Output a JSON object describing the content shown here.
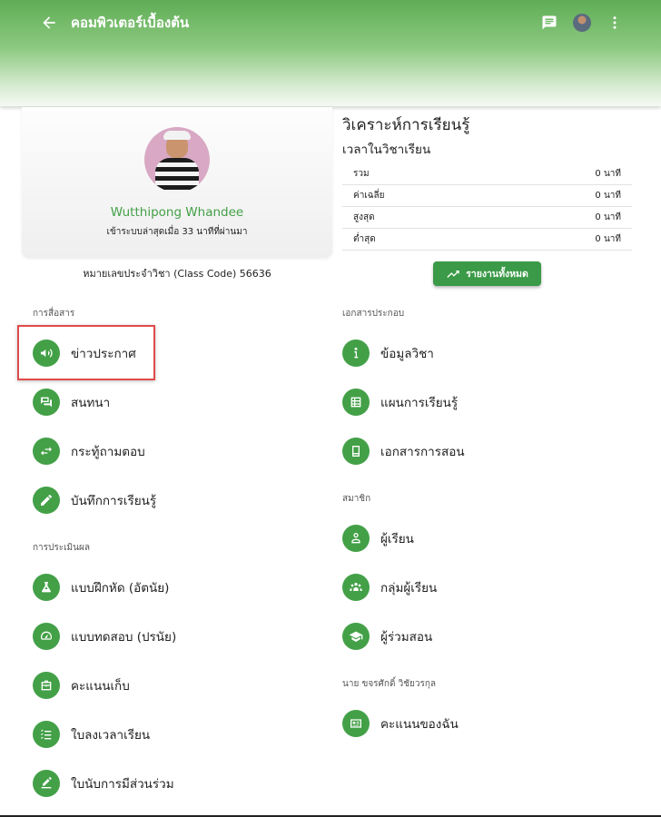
{
  "header": {
    "title": "คอมพิวเตอร์เบื้องต้น",
    "back_icon": "arrow-back-icon",
    "chat_icon": "chat-icon",
    "more_icon": "more-vert-icon"
  },
  "profile": {
    "name": "Wutthipong Whandee",
    "last_login": "เข้าระบบล่าสุดเมื่อ 33 นาทีที่ผ่านมา",
    "class_code": "หมายเลขประจำวิชา (Class Code) 56636"
  },
  "analytics": {
    "title": "วิเคราะห์การเรียนรู้",
    "subtitle": "เวลาในวิชาเรียน",
    "rows": [
      {
        "label": "รวม",
        "value": "0 นาที"
      },
      {
        "label": "ค่าเฉลี่ย",
        "value": "0 นาที"
      },
      {
        "label": "สูงสุด",
        "value": "0 นาที"
      },
      {
        "label": "ต่ำสุด",
        "value": "0 นาที"
      }
    ],
    "report_button": "รายงานทั้งหมด"
  },
  "sections": {
    "communication": {
      "label": "การสื่อสาร",
      "items": [
        {
          "label": "ข่าวประกาศ",
          "icon": "megaphone-icon"
        },
        {
          "label": "สนทนา",
          "icon": "forum-icon"
        },
        {
          "label": "กระทู้ถามตอบ",
          "icon": "swap-icon"
        },
        {
          "label": "บันทึกการเรียนรู้",
          "icon": "pencil-icon"
        }
      ]
    },
    "assessment": {
      "label": "การประเมินผล",
      "items": [
        {
          "label": "แบบฝึกหัด (อัตนัย)",
          "icon": "flask-icon"
        },
        {
          "label": "แบบทดสอบ (ปรนัย)",
          "icon": "speedometer-icon"
        },
        {
          "label": "คะแนนเก็บ",
          "icon": "briefcase-icon"
        },
        {
          "label": "ใบลงเวลาเรียน",
          "icon": "checklist-icon"
        },
        {
          "label": "ใบนับการมีส่วนร่วม",
          "icon": "edit-note-icon"
        }
      ]
    },
    "documents": {
      "label": "เอกสารประกอบ",
      "items": [
        {
          "label": "ข้อมูลวิชา",
          "icon": "info-icon"
        },
        {
          "label": "แผนการเรียนรู้",
          "icon": "table-icon"
        },
        {
          "label": "เอกสารการสอน",
          "icon": "book-icon"
        }
      ]
    },
    "members": {
      "label": "สมาชิก",
      "items": [
        {
          "label": "ผู้เรียน",
          "icon": "person-icon"
        },
        {
          "label": "กลุ่มผู้เรียน",
          "icon": "group-icon"
        },
        {
          "label": "ผู้ร่วมสอน",
          "icon": "graduation-cap-icon"
        }
      ]
    },
    "teacher": {
      "label": "นาย ขจรศักดิ์ วิชัยวรกุล",
      "items": [
        {
          "label": "คะแนนของฉัน",
          "icon": "id-card-icon"
        }
      ]
    }
  },
  "colors": {
    "accent": "#43a047",
    "header_top": "#5fad56",
    "highlight": "#e04b4b"
  }
}
